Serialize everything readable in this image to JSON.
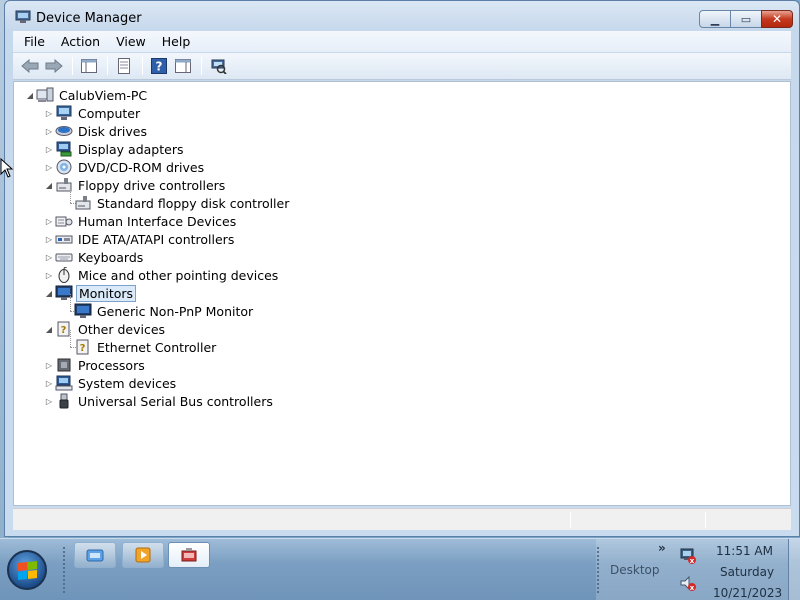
{
  "window": {
    "title": "Device Manager",
    "buttons": {
      "minimize": "minimize",
      "maximize": "maximize",
      "close": "close"
    }
  },
  "menu": [
    "File",
    "Action",
    "View",
    "Help"
  ],
  "toolbar": {
    "icons": [
      "back-icon",
      "forward-icon",
      "show-hide-console-tree-icon",
      "properties-icon",
      "help-icon",
      "show-action-pane-icon",
      "scan-hardware-icon"
    ]
  },
  "tree": {
    "root": "CalubViem-PC",
    "nodes": [
      {
        "label": "Computer",
        "icon": "computer-icon",
        "expanded": false
      },
      {
        "label": "Disk drives",
        "icon": "disk-drive-icon",
        "expanded": false
      },
      {
        "label": "Display adapters",
        "icon": "display-adapter-icon",
        "expanded": false
      },
      {
        "label": "DVD/CD-ROM drives",
        "icon": "dvd-drive-icon",
        "expanded": false
      },
      {
        "label": "Floppy drive controllers",
        "icon": "floppy-controller-icon",
        "expanded": true,
        "children": [
          {
            "label": "Standard floppy disk controller",
            "icon": "floppy-controller-icon"
          }
        ]
      },
      {
        "label": "Human Interface Devices",
        "icon": "hid-icon",
        "expanded": false
      },
      {
        "label": "IDE ATA/ATAPI controllers",
        "icon": "ide-controller-icon",
        "expanded": false
      },
      {
        "label": "Keyboards",
        "icon": "keyboard-icon",
        "expanded": false
      },
      {
        "label": "Mice and other pointing devices",
        "icon": "mouse-icon",
        "expanded": false
      },
      {
        "label": "Monitors",
        "icon": "monitor-icon",
        "expanded": true,
        "selected": true,
        "children": [
          {
            "label": "Generic Non-PnP Monitor",
            "icon": "monitor-icon"
          }
        ]
      },
      {
        "label": "Other devices",
        "icon": "unknown-device-icon",
        "expanded": true,
        "children": [
          {
            "label": "Ethernet Controller",
            "icon": "unknown-device-icon"
          }
        ]
      },
      {
        "label": "Processors",
        "icon": "processor-icon",
        "expanded": false
      },
      {
        "label": "System devices",
        "icon": "system-device-icon",
        "expanded": false
      },
      {
        "label": "Universal Serial Bus controllers",
        "icon": "usb-icon",
        "expanded": false
      }
    ]
  },
  "taskbar": {
    "tray": {
      "desktop_label": "Desktop",
      "overflow": "»",
      "time": "11:51 AM",
      "day": "Saturday",
      "date": "10/21/2023"
    }
  },
  "colors": {
    "accent": "#3a6ea5",
    "selection": "#dbeaf9",
    "close_button": "#c43a1e"
  }
}
